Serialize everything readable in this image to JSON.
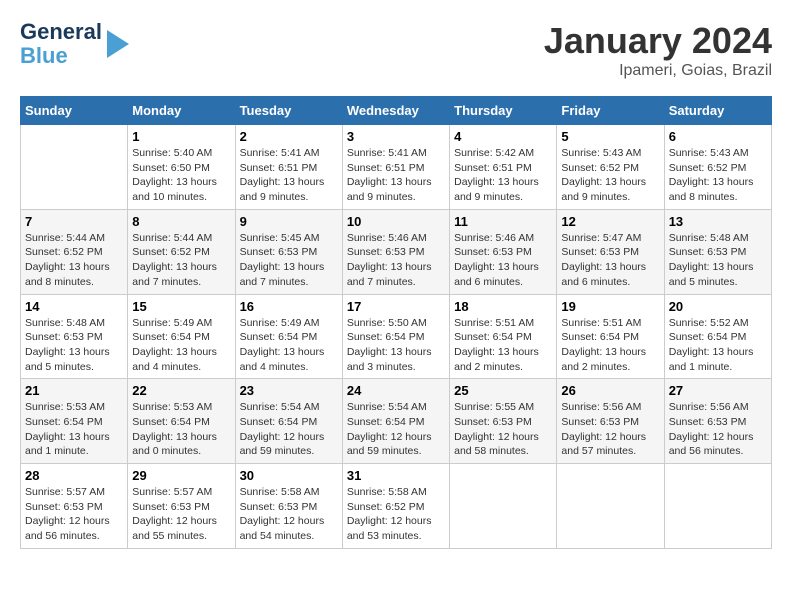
{
  "header": {
    "logo_line1": "General",
    "logo_line2": "Blue",
    "month_title": "January 2024",
    "location": "Ipameri, Goias, Brazil"
  },
  "days_of_week": [
    "Sunday",
    "Monday",
    "Tuesday",
    "Wednesday",
    "Thursday",
    "Friday",
    "Saturday"
  ],
  "weeks": [
    [
      {
        "day": "",
        "info": ""
      },
      {
        "day": "1",
        "info": "Sunrise: 5:40 AM\nSunset: 6:50 PM\nDaylight: 13 hours\nand 10 minutes."
      },
      {
        "day": "2",
        "info": "Sunrise: 5:41 AM\nSunset: 6:51 PM\nDaylight: 13 hours\nand 9 minutes."
      },
      {
        "day": "3",
        "info": "Sunrise: 5:41 AM\nSunset: 6:51 PM\nDaylight: 13 hours\nand 9 minutes."
      },
      {
        "day": "4",
        "info": "Sunrise: 5:42 AM\nSunset: 6:51 PM\nDaylight: 13 hours\nand 9 minutes."
      },
      {
        "day": "5",
        "info": "Sunrise: 5:43 AM\nSunset: 6:52 PM\nDaylight: 13 hours\nand 9 minutes."
      },
      {
        "day": "6",
        "info": "Sunrise: 5:43 AM\nSunset: 6:52 PM\nDaylight: 13 hours\nand 8 minutes."
      }
    ],
    [
      {
        "day": "7",
        "info": "Sunrise: 5:44 AM\nSunset: 6:52 PM\nDaylight: 13 hours\nand 8 minutes."
      },
      {
        "day": "8",
        "info": "Sunrise: 5:44 AM\nSunset: 6:52 PM\nDaylight: 13 hours\nand 7 minutes."
      },
      {
        "day": "9",
        "info": "Sunrise: 5:45 AM\nSunset: 6:53 PM\nDaylight: 13 hours\nand 7 minutes."
      },
      {
        "day": "10",
        "info": "Sunrise: 5:46 AM\nSunset: 6:53 PM\nDaylight: 13 hours\nand 7 minutes."
      },
      {
        "day": "11",
        "info": "Sunrise: 5:46 AM\nSunset: 6:53 PM\nDaylight: 13 hours\nand 6 minutes."
      },
      {
        "day": "12",
        "info": "Sunrise: 5:47 AM\nSunset: 6:53 PM\nDaylight: 13 hours\nand 6 minutes."
      },
      {
        "day": "13",
        "info": "Sunrise: 5:48 AM\nSunset: 6:53 PM\nDaylight: 13 hours\nand 5 minutes."
      }
    ],
    [
      {
        "day": "14",
        "info": "Sunrise: 5:48 AM\nSunset: 6:53 PM\nDaylight: 13 hours\nand 5 minutes."
      },
      {
        "day": "15",
        "info": "Sunrise: 5:49 AM\nSunset: 6:54 PM\nDaylight: 13 hours\nand 4 minutes."
      },
      {
        "day": "16",
        "info": "Sunrise: 5:49 AM\nSunset: 6:54 PM\nDaylight: 13 hours\nand 4 minutes."
      },
      {
        "day": "17",
        "info": "Sunrise: 5:50 AM\nSunset: 6:54 PM\nDaylight: 13 hours\nand 3 minutes."
      },
      {
        "day": "18",
        "info": "Sunrise: 5:51 AM\nSunset: 6:54 PM\nDaylight: 13 hours\nand 2 minutes."
      },
      {
        "day": "19",
        "info": "Sunrise: 5:51 AM\nSunset: 6:54 PM\nDaylight: 13 hours\nand 2 minutes."
      },
      {
        "day": "20",
        "info": "Sunrise: 5:52 AM\nSunset: 6:54 PM\nDaylight: 13 hours\nand 1 minute."
      }
    ],
    [
      {
        "day": "21",
        "info": "Sunrise: 5:53 AM\nSunset: 6:54 PM\nDaylight: 13 hours\nand 1 minute."
      },
      {
        "day": "22",
        "info": "Sunrise: 5:53 AM\nSunset: 6:54 PM\nDaylight: 13 hours\nand 0 minutes."
      },
      {
        "day": "23",
        "info": "Sunrise: 5:54 AM\nSunset: 6:54 PM\nDaylight: 12 hours\nand 59 minutes."
      },
      {
        "day": "24",
        "info": "Sunrise: 5:54 AM\nSunset: 6:54 PM\nDaylight: 12 hours\nand 59 minutes."
      },
      {
        "day": "25",
        "info": "Sunrise: 5:55 AM\nSunset: 6:53 PM\nDaylight: 12 hours\nand 58 minutes."
      },
      {
        "day": "26",
        "info": "Sunrise: 5:56 AM\nSunset: 6:53 PM\nDaylight: 12 hours\nand 57 minutes."
      },
      {
        "day": "27",
        "info": "Sunrise: 5:56 AM\nSunset: 6:53 PM\nDaylight: 12 hours\nand 56 minutes."
      }
    ],
    [
      {
        "day": "28",
        "info": "Sunrise: 5:57 AM\nSunset: 6:53 PM\nDaylight: 12 hours\nand 56 minutes."
      },
      {
        "day": "29",
        "info": "Sunrise: 5:57 AM\nSunset: 6:53 PM\nDaylight: 12 hours\nand 55 minutes."
      },
      {
        "day": "30",
        "info": "Sunrise: 5:58 AM\nSunset: 6:53 PM\nDaylight: 12 hours\nand 54 minutes."
      },
      {
        "day": "31",
        "info": "Sunrise: 5:58 AM\nSunset: 6:52 PM\nDaylight: 12 hours\nand 53 minutes."
      },
      {
        "day": "",
        "info": ""
      },
      {
        "day": "",
        "info": ""
      },
      {
        "day": "",
        "info": ""
      }
    ]
  ]
}
